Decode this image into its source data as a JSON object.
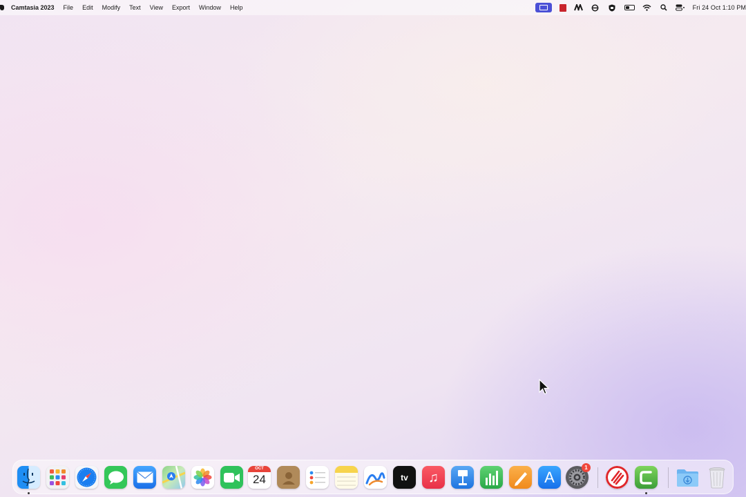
{
  "menubar": {
    "app_name": "Camtasia 2023",
    "menus": [
      "File",
      "Edit",
      "Modify",
      "Text",
      "View",
      "Export",
      "Window",
      "Help"
    ],
    "clock": "Fri 24 Oct  1:10 PM",
    "status_icons": [
      "screen-recording-icon",
      "red-app-icon",
      "a-logo-icon",
      "sync-icon",
      "shield-icon",
      "battery-icon",
      "wifi-icon",
      "search-icon",
      "control-center-icon"
    ]
  },
  "dock": {
    "calendar": {
      "month": "OCT",
      "day": "24"
    },
    "system_settings_badge": "1",
    "apps": [
      "Finder",
      "Launchpad",
      "Safari",
      "Messages",
      "Mail",
      "Maps",
      "Photos",
      "FaceTime",
      "Calendar",
      "Contacts",
      "Reminders",
      "Notes",
      "Freeform",
      "TV",
      "Music",
      "Keynote",
      "Numbers",
      "Pages",
      "App Store",
      "System Settings",
      "Camtasia Recorder",
      "Camtasia 2023",
      "Downloads",
      "Trash"
    ],
    "glyphs": {
      "appletv": "tv",
      "music": "♫",
      "appstore": "A"
    },
    "colors": {
      "finder": "#1e8ef4",
      "safari": "#1a7ef0",
      "messages": "#34c759",
      "mail": "#2f8af5",
      "facetime": "#2fc25b",
      "contacts": "#b08a5a",
      "notes": "#f7d44c",
      "tv": "#111111",
      "music": "#f0404f",
      "keynote": "#2a86e8",
      "numbers": "#33b84f",
      "pages": "#f49a24",
      "appstore": "#1d7ef5",
      "settings": "#8a8a8e",
      "recorder": "#e0262a",
      "camtasia": "#5cb848",
      "downloads": "#6cb4f0"
    }
  }
}
